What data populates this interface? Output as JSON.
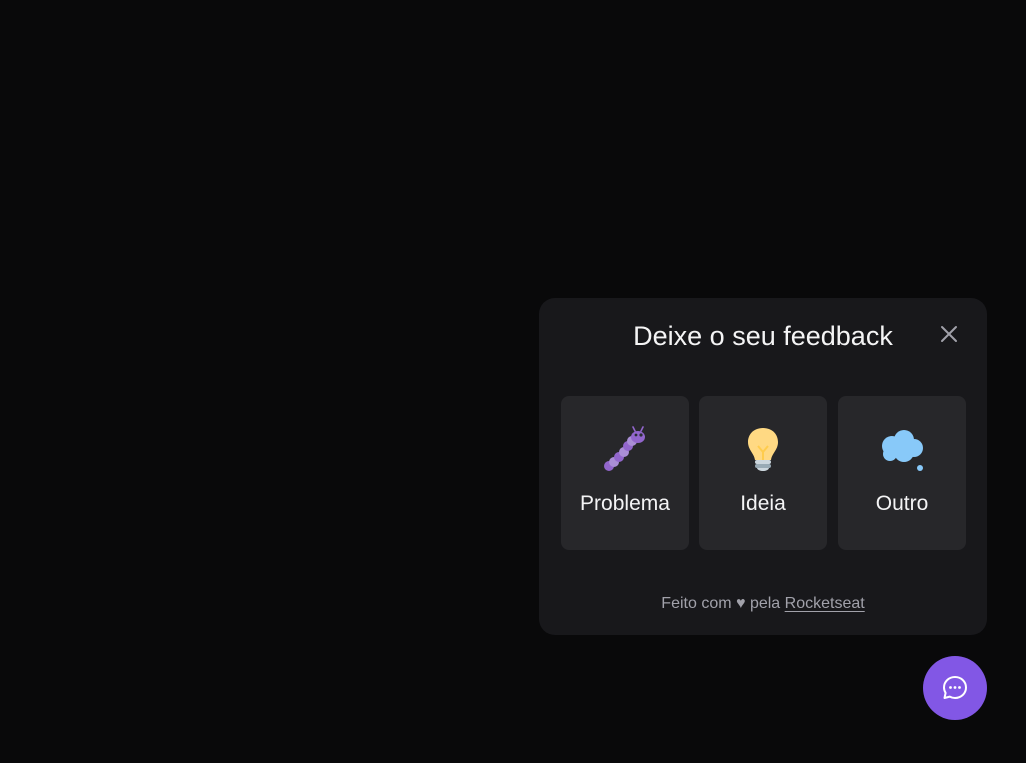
{
  "widget": {
    "title": "Deixe o seu feedback",
    "close_icon": "close-icon",
    "options": [
      {
        "label": "Problema",
        "icon": "bug-icon"
      },
      {
        "label": "Ideia",
        "icon": "lightbulb-icon"
      },
      {
        "label": "Outro",
        "icon": "thought-balloon-icon"
      }
    ],
    "footer": {
      "prefix": "Feito com",
      "heart": "♥",
      "middle": "pela",
      "link": "Rocketseat"
    }
  },
  "fab": {
    "icon": "chat-bubble-icon"
  },
  "colors": {
    "background": "#09090a",
    "surface": "#18181b",
    "card": "#27272a",
    "accent": "#8257e5",
    "text": "#f4f4f5",
    "muted": "#a1a1aa"
  }
}
